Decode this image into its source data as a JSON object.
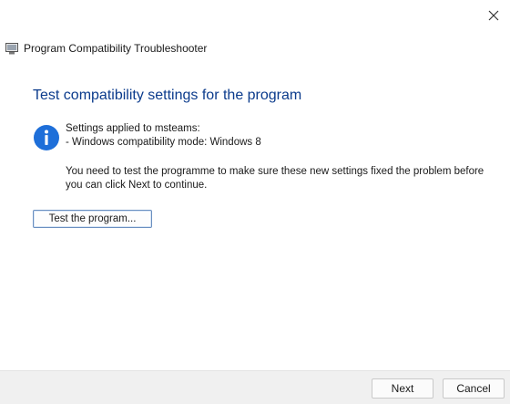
{
  "window": {
    "title": "Program Compatibility Troubleshooter",
    "close_icon": "close-icon",
    "app_icon": "troubleshooter-icon"
  },
  "content": {
    "heading": "Test compatibility settings for the program",
    "info_icon": "info-icon",
    "settings_applied": "Settings applied to msteams:",
    "compat_mode": "- Windows compatibility mode: Windows 8",
    "message": "You need to test the programme to make sure these new settings fixed the problem before you can click Next to continue.",
    "test_button_label": "Test the program..."
  },
  "footer": {
    "next_label": "Next",
    "cancel_label": "Cancel"
  },
  "colors": {
    "heading": "#0b3b8c",
    "info_blue": "#1e6fd9",
    "footer_bg": "#f0f0f0"
  }
}
